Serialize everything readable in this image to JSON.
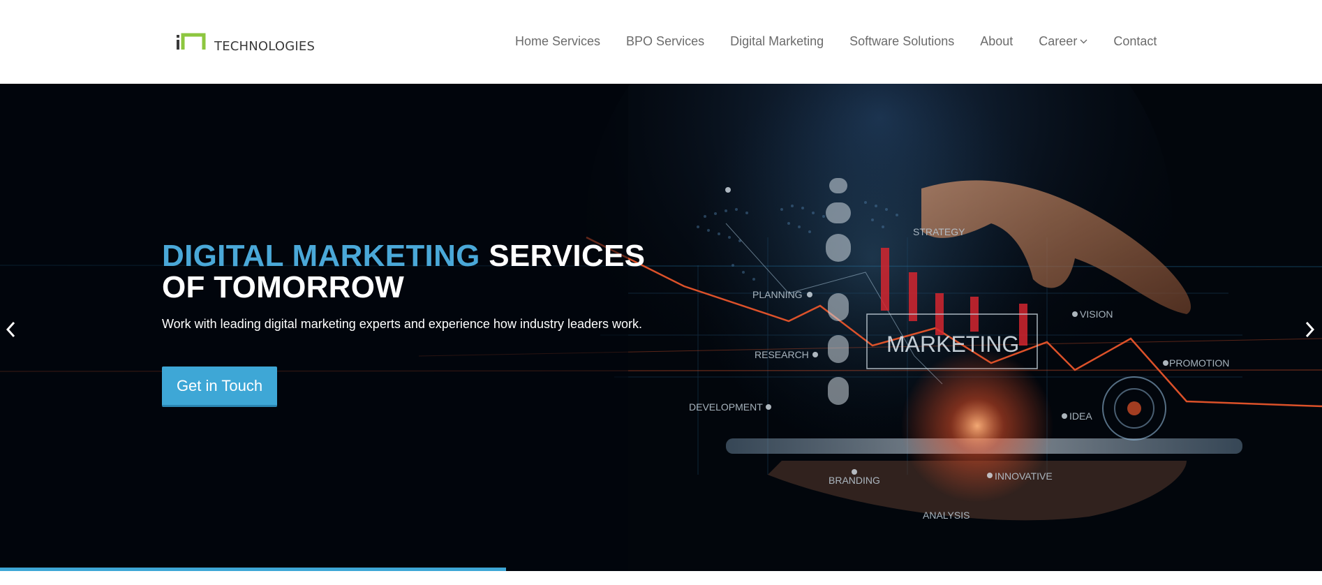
{
  "header": {
    "logo": {
      "mark_icon": "in-logo-icon",
      "text": "TECHNOLOGIES",
      "mark_color": "#8dc63f",
      "mark_dark": "#3a3a3a"
    },
    "nav": [
      {
        "label": "Home Services"
      },
      {
        "label": "BPO Services"
      },
      {
        "label": "Digital Marketing"
      },
      {
        "label": "Software Solutions"
      },
      {
        "label": "About"
      },
      {
        "label": "Career",
        "icon": "chevron-down-icon"
      },
      {
        "label": "Contact"
      }
    ]
  },
  "hero": {
    "headline_accent": "DIGITAL MARKETING",
    "headline_rest": " SERVICES",
    "headline_line2": "OF TOMORROW",
    "subline": "Work with leading digital marketing experts and experience how industry leaders work.",
    "cta_label": "Get in Touch",
    "prev_icon": "chevron-left-icon",
    "next_icon": "chevron-right-icon",
    "slide_progress": 0.383,
    "graphic_labels": {
      "strategy": "STRATEGY",
      "planning": "PLANNING",
      "research": "RESEARCH",
      "development": "DEVELOPMENT",
      "marketing": "MARKETING",
      "vision": "VISION",
      "promotion": "PROMOTION",
      "idea": "IDEA",
      "branding": "BRANDING",
      "innovative": "INNOVATIVE",
      "analysis": "ANALYSIS"
    }
  },
  "colors": {
    "accent": "#4aa8d8",
    "button": "#3ea7d6",
    "nav_text": "#6b6b6b",
    "hero_bg": "#02060c"
  }
}
